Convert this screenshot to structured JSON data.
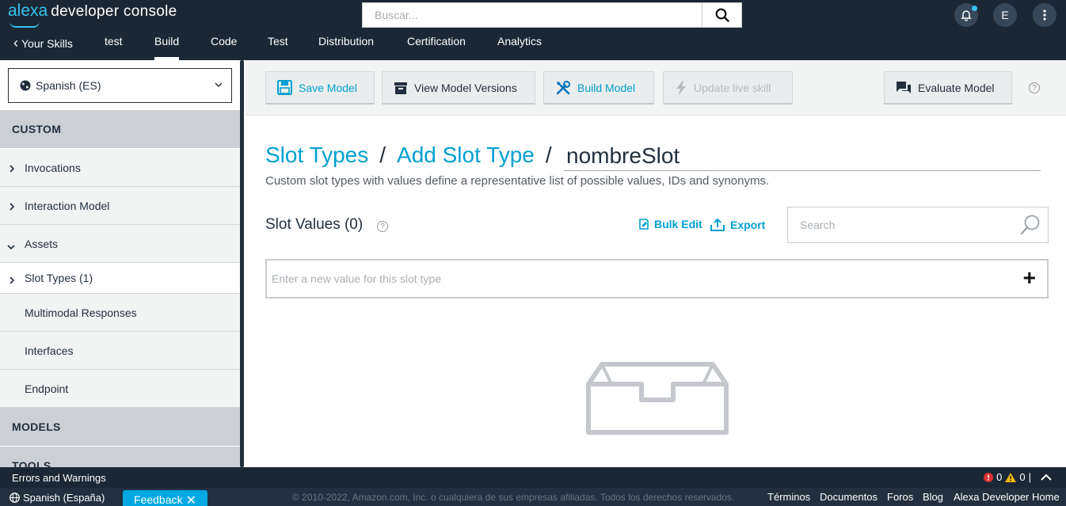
{
  "header": {
    "logo_brand": "alexa",
    "logo_text": "developer console",
    "search_placeholder": "Buscar...",
    "avatar_initial": "E"
  },
  "nav": {
    "items": [
      {
        "label": "Your Skills",
        "prefix": "‹"
      },
      {
        "label": "test"
      },
      {
        "label": "Build",
        "active": true
      },
      {
        "label": "Code"
      },
      {
        "label": "Test"
      },
      {
        "label": "Distribution"
      },
      {
        "label": "Certification"
      },
      {
        "label": "Analytics"
      }
    ]
  },
  "sidebar": {
    "language": "Spanish (ES)",
    "custom_header": "CUSTOM",
    "items": [
      {
        "label": "Invocations",
        "arrow": "›"
      },
      {
        "label": "Interaction Model",
        "arrow": "›"
      },
      {
        "label": "Assets",
        "arrow": "⌄"
      },
      {
        "label": "Slot Types (1)",
        "arrow": "›"
      },
      {
        "label": "Multimodal Responses"
      },
      {
        "label": "Interfaces"
      },
      {
        "label": "Endpoint"
      }
    ],
    "models_header": "MODELS",
    "tools_header": "TOOLS"
  },
  "toolbar": {
    "save_model": "Save Model",
    "view_versions": "View Model Versions",
    "build_model": "Build Model",
    "update_live": "Update live skill",
    "evaluate_model": "Evaluate Model",
    "help": "?"
  },
  "main": {
    "breadcrumb_1": "Slot Types",
    "breadcrumb_2": "Add Slot Type",
    "separator": "/",
    "slot_name": "nombreSlot",
    "description": "Custom slot types with values define a representative list of possible values, IDs and synonyms.",
    "slot_values_title": "Slot Values (0)",
    "help": "?",
    "bulk_edit": "Bulk Edit",
    "export": "Export",
    "search_placeholder": "Search",
    "new_value_placeholder": "Enter a new value for this slot type",
    "add_symbol": "+"
  },
  "error_bar": {
    "title": "Errors and Warnings",
    "error_count": "0",
    "warning_count": "0",
    "separator": "|",
    "collapse_icon": "︿"
  },
  "footer": {
    "language": "Spanish (España)",
    "feedback": "Feedback",
    "feedback_close": "✕",
    "copyright": "© 2010-2022, Amazon.com, Inc. o cualquiera de sus empresas afiliadas. Todos los derechos reservados.",
    "links": [
      "Términos",
      "Documentos",
      "Foros",
      "Blog",
      "Alexa Developer Home"
    ]
  },
  "colors": {
    "header_bg": "#1b2734",
    "accent": "#00a0d2",
    "feedback": "#00a8e1",
    "sidebar_section": "#ccd0d4"
  }
}
